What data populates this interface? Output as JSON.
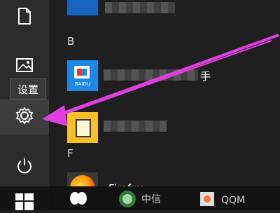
{
  "left_rail": {
    "tooltip": "设置",
    "items": [
      {
        "name": "document-icon"
      },
      {
        "name": "pictures-icon"
      },
      {
        "name": "settings-icon"
      },
      {
        "name": "power-icon"
      }
    ]
  },
  "apps": {
    "group_b": "B",
    "group_f": "F",
    "baidu_tile_text": "BAIDU",
    "baidu_partial_label": "手",
    "firefox_label": "Firefox"
  },
  "taskbar": {
    "item1_text": "中信",
    "item2_text": "QQM"
  },
  "colors": {
    "accent_arrow": "#e040e0",
    "tile_blue": "#1565c0",
    "baidu_blue": "#1e88e5",
    "yellow_tile": "#f6c026"
  }
}
